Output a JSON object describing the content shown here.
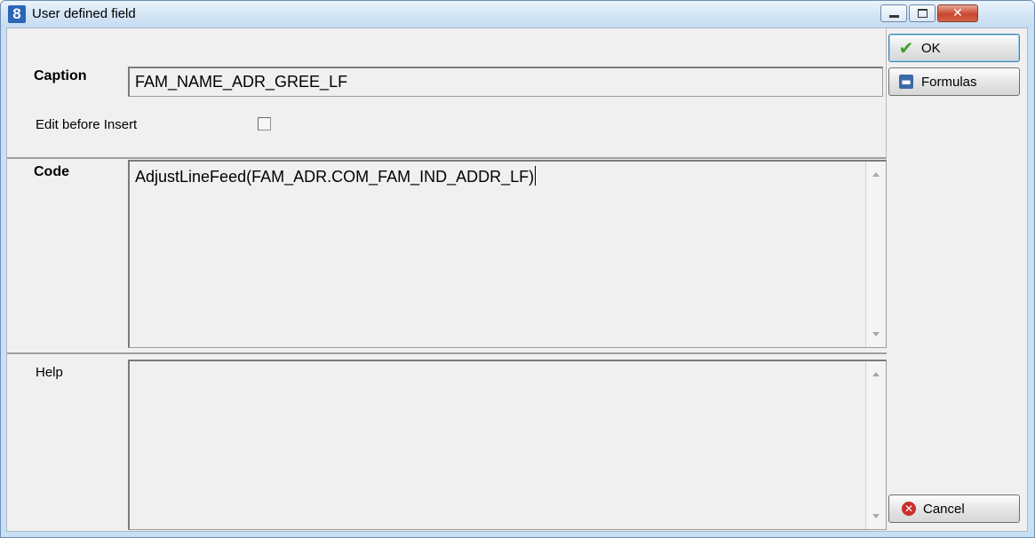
{
  "window": {
    "title": "User defined field",
    "icon": "app-8-icon",
    "controls": [
      "minimize-icon",
      "maximize-icon",
      "close-icon"
    ]
  },
  "form": {
    "caption_label": "Caption",
    "caption_value": "FAM_NAME_ADR_GREE_LF",
    "edit_before_insert_label": "Edit before Insert",
    "edit_before_insert_checked": false,
    "code_label": "Code",
    "code_value": "AdjustLineFeed(FAM_ADR.COM_FAM_IND_ADDR_LF)",
    "help_label": "Help",
    "help_value": ""
  },
  "buttons": {
    "ok": {
      "label": "OK",
      "icon": "checkmark-icon"
    },
    "formulas": {
      "label": "Formulas",
      "icon": "floppy-disk-icon"
    },
    "cancel": {
      "label": "Cancel",
      "icon": "cancel-x-icon"
    }
  },
  "colors": {
    "title_bar": "#d3e5f6",
    "client_bg": "#f0f0f0",
    "close_button": "#c8472f",
    "ok_check": "#3f9f2a"
  }
}
